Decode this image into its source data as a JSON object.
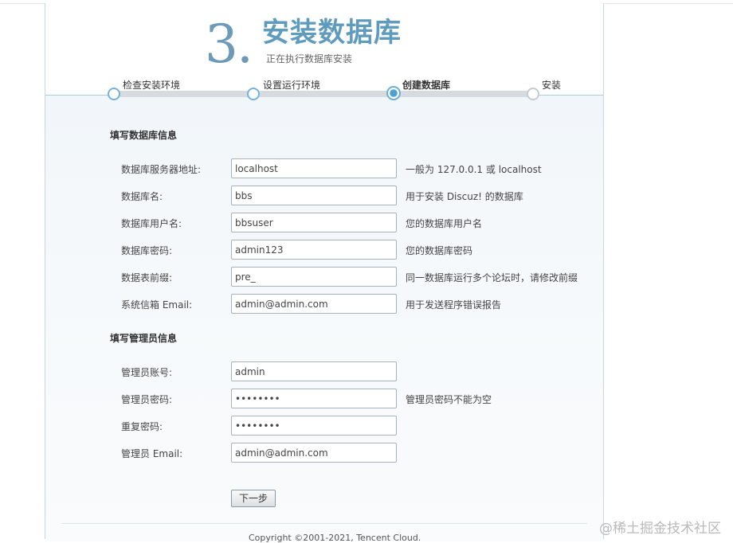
{
  "header": {
    "step_number": "3.",
    "title": "安装数据库",
    "subtitle": "正在执行数据库安装"
  },
  "steps": [
    {
      "label": "检查安装环境",
      "state": "done"
    },
    {
      "label": "设置运行环境",
      "state": "done"
    },
    {
      "label": "创建数据库",
      "state": "current"
    },
    {
      "label": "安装",
      "state": "todo"
    }
  ],
  "db_section": {
    "title": "填写数据库信息",
    "rows": [
      {
        "label": "数据库服务器地址:",
        "value": "localhost",
        "hint": "一般为 127.0.0.1 或 localhost"
      },
      {
        "label": "数据库名:",
        "value": "bbs",
        "hint": "用于安装 Discuz! 的数据库"
      },
      {
        "label": "数据库用户名:",
        "value": "bbsuser",
        "hint": "您的数据库用户名"
      },
      {
        "label": "数据库密码:",
        "value": "admin123",
        "hint": "您的数据库密码"
      },
      {
        "label": "数据表前缀:",
        "value": "pre_",
        "hint": "同一数据库运行多个论坛时，请修改前缀"
      },
      {
        "label": "系统信箱 Email:",
        "value": "admin@admin.com",
        "hint": "用于发送程序错误报告"
      }
    ]
  },
  "admin_section": {
    "title": "填写管理员信息",
    "rows": [
      {
        "label": "管理员账号:",
        "value": "admin",
        "hint": ""
      },
      {
        "label": "管理员密码:",
        "value": "••••••••",
        "hint": "管理员密码不能为空"
      },
      {
        "label": "重复密码:",
        "value": "••••••••",
        "hint": ""
      },
      {
        "label": "管理员 Email:",
        "value": "admin@admin.com",
        "hint": ""
      }
    ]
  },
  "actions": {
    "next_label": "下一步"
  },
  "footer": {
    "copyright": "Copyright ©2001-2021, Tencent Cloud."
  },
  "watermark": "@稀土掘金技术社区",
  "colors": {
    "accent": "#5f9bbd",
    "border": "#a6b2bc",
    "progress": "#d6dbdf"
  }
}
